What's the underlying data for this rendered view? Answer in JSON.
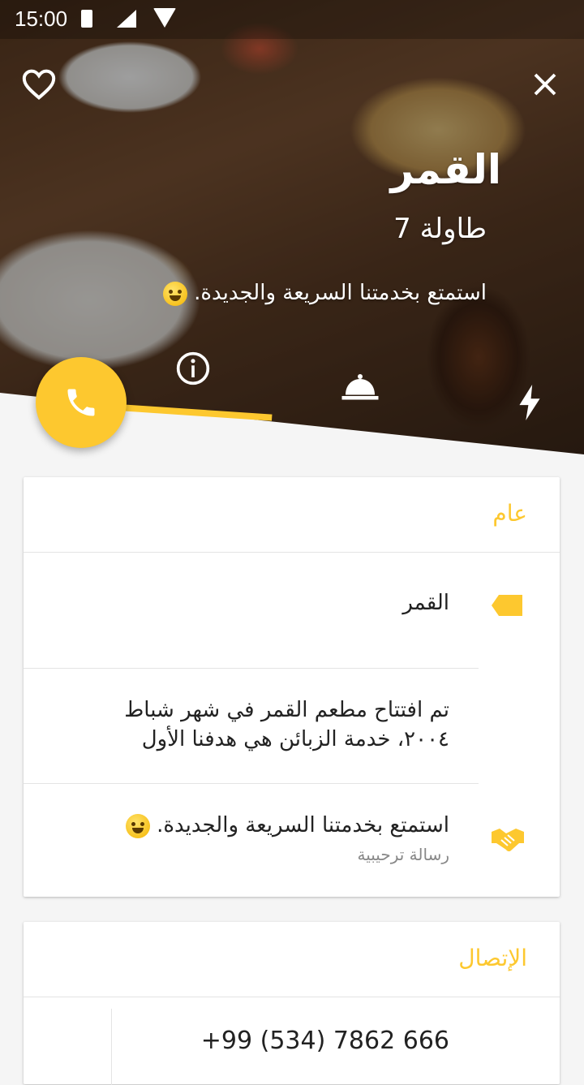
{
  "status_bar": {
    "time": "15:00"
  },
  "hero": {
    "title": "القمر",
    "table": "طاولة 7",
    "welcome": "استمتع بخدمتنا السريعة والجديدة."
  },
  "icons": {
    "favorite": "heart-icon",
    "close": "close-icon",
    "info": "info-icon",
    "service": "service-bell-icon",
    "quick": "lightning-icon",
    "call": "phone-icon"
  },
  "accent_color": "#fdc82f",
  "general": {
    "header": "عام",
    "name": "القمر",
    "description": "تم افتتاح مطعم القمر في شهر شباط ٢٠٠٤، خدمة الزبائن هي هدفنا الأول",
    "welcome_message": "استمتع بخدمتنا السريعة والجديدة.",
    "welcome_label": "رسالة ترحيبية"
  },
  "contact": {
    "header": "الإتصال",
    "phone": "+99 (534) 7862 666"
  }
}
